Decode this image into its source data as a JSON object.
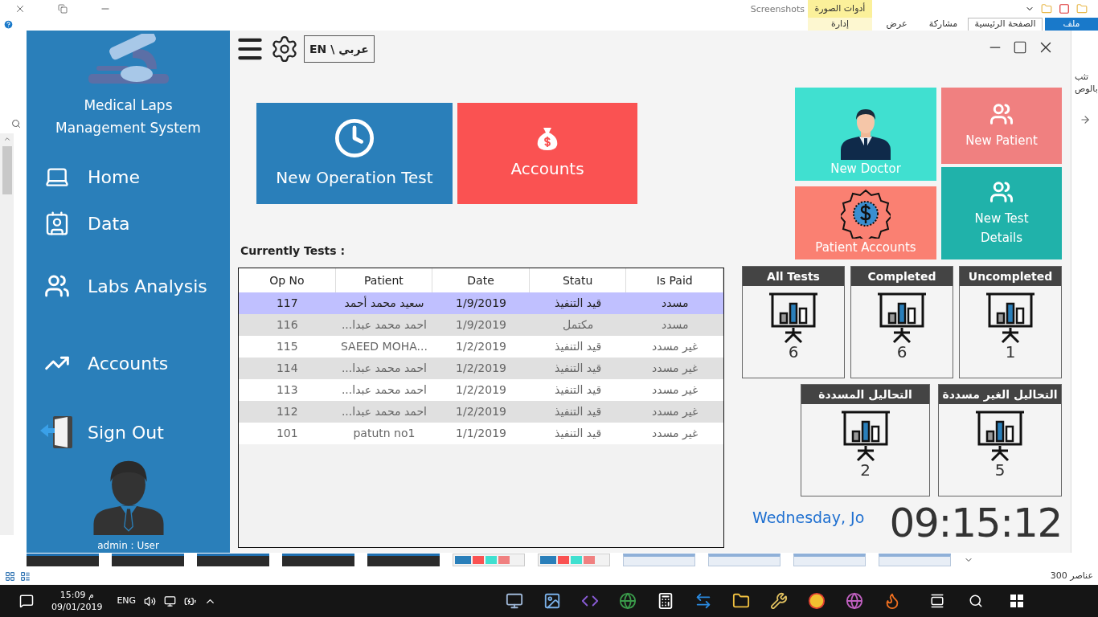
{
  "explorer": {
    "title": "Screenshots",
    "context_label": "أدوات الصورة",
    "ribbon_tabs": [
      {
        "label": "ملف",
        "kind": "file",
        "selected": false
      },
      {
        "label": "الصفحة الرئيسية",
        "kind": "tab",
        "selected": true
      },
      {
        "label": "مشاركة",
        "kind": "tab",
        "selected": false
      },
      {
        "label": "عرض",
        "kind": "tab",
        "selected": false
      },
      {
        "label": "إدارة",
        "kind": "context",
        "selected": false
      }
    ],
    "side_texts": [
      "تثب",
      "بالوص"
    ],
    "thumbnails": [
      {
        "kind": "dark"
      },
      {
        "kind": "dark"
      },
      {
        "kind": "dark"
      },
      {
        "kind": "dark"
      },
      {
        "kind": "dark"
      },
      {
        "kind": "app"
      },
      {
        "kind": "app"
      },
      {
        "kind": "sheet"
      },
      {
        "kind": "sheet"
      },
      {
        "kind": "sheet"
      },
      {
        "kind": "sheet"
      }
    ],
    "status": "300 عناصر"
  },
  "app": {
    "language_button": "EN \\ عربي",
    "logo_title": [
      "Medical Laps",
      "Management System"
    ],
    "nav": [
      {
        "label": "Home"
      },
      {
        "label": "Data"
      },
      {
        "label": "Labs Analysis"
      },
      {
        "label": "Accounts"
      },
      {
        "label": "Sign Out"
      }
    ],
    "user": "admin : User",
    "big_tiles": [
      {
        "label": "New Operation Test",
        "color": "#2a7fba"
      },
      {
        "label": "Accounts",
        "color": "#fa5252"
      }
    ],
    "table_title": "Currently Tests :",
    "table": {
      "columns": [
        "Is Paid",
        "Statu",
        "Date",
        "Patient",
        "Op No"
      ],
      "rows": [
        {
          "cells": [
            "مسدد",
            "قيد التنفيذ",
            "1/9/2019",
            "سعيد محمد أحمد",
            "117"
          ],
          "selected": true
        },
        {
          "cells": [
            "مسدد",
            "مكتمل",
            "1/9/2019",
            "...احمد محمد عبدا",
            "116"
          ],
          "selected": false
        },
        {
          "cells": [
            "غير مسدد",
            "قيد التنفيذ",
            "1/2/2019",
            "SAEED MOHA...",
            "115"
          ],
          "selected": false
        },
        {
          "cells": [
            "غير مسدد",
            "قيد التنفيذ",
            "1/2/2019",
            "...احمد محمد عبدا",
            "114"
          ],
          "selected": false
        },
        {
          "cells": [
            "غير مسدد",
            "قيد التنفيذ",
            "1/2/2019",
            "...احمد محمد عبدا",
            "113"
          ],
          "selected": false
        },
        {
          "cells": [
            "غير مسدد",
            "قيد التنفيذ",
            "1/2/2019",
            "...احمد محمد عبدا",
            "112"
          ],
          "selected": false
        },
        {
          "cells": [
            "غير مسدد",
            "قيد التنفيذ",
            "1/1/2019",
            "patutn no1",
            "101"
          ],
          "selected": false
        }
      ]
    },
    "action_tiles": [
      {
        "label": "New Doctor",
        "color": "#40e0d0"
      },
      {
        "label": "Patient Accounts",
        "color": "#fa8072"
      },
      {
        "label": "New Patient",
        "color": "#f08080"
      },
      {
        "label": "New Test Details",
        "color": "#20b2aa"
      }
    ],
    "test_stats": [
      {
        "title": "Uncompleted",
        "value": "1"
      },
      {
        "title": "Completed",
        "value": "6"
      },
      {
        "title": "All Tests",
        "value": "6"
      }
    ],
    "payment_stats": [
      {
        "title": "التحاليل الغير مسددة",
        "value": "5"
      },
      {
        "title": "التحاليل المسددة",
        "value": "2"
      }
    ],
    "date": "Wednesday, Jo",
    "time": "09:15:12"
  },
  "taskbar": {
    "time": "15:09 م",
    "date": "09/01/2019",
    "language": "ENG"
  }
}
